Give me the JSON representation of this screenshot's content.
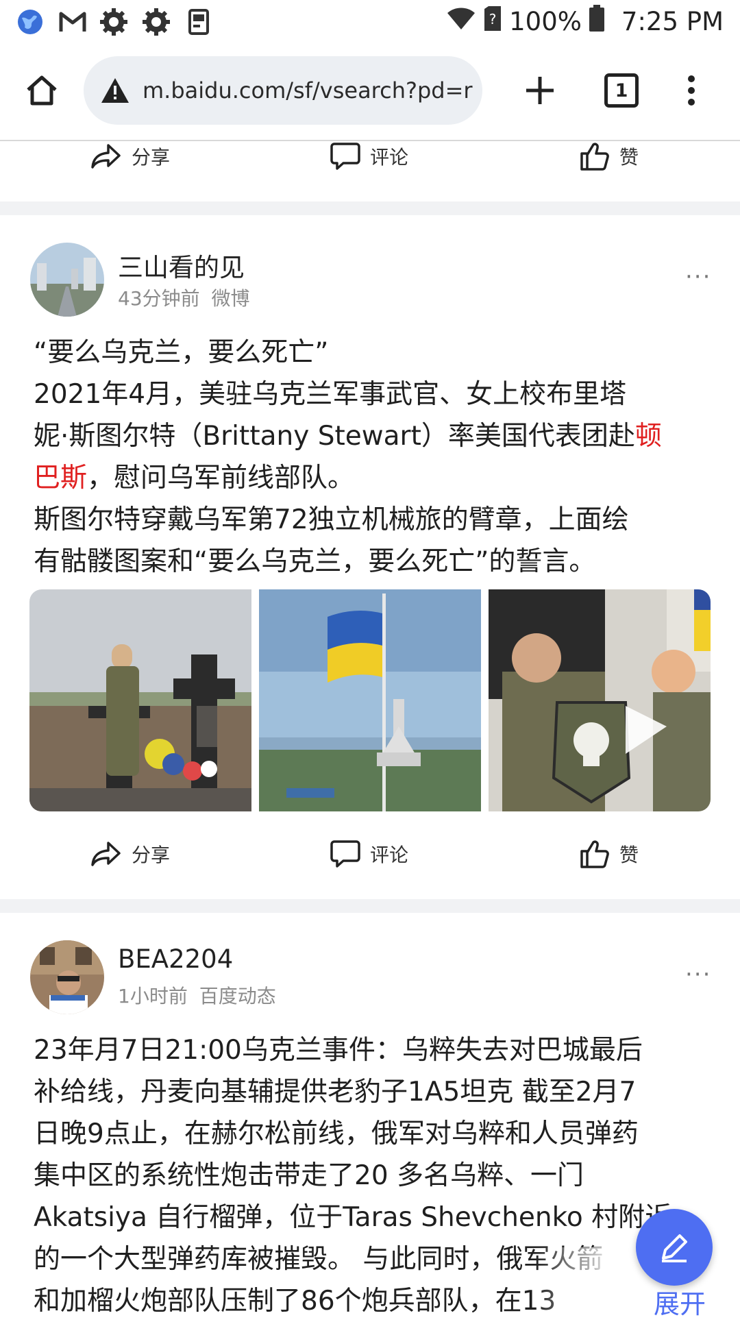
{
  "status_bar": {
    "battery": "100%",
    "time": "7:25 PM",
    "icons": [
      "globe-icon",
      "gmail-icon",
      "settings-gear-icon",
      "settings-gear-icon",
      "reader-app-icon",
      "wifi-icon",
      "sim-unknown-icon",
      "battery-icon"
    ]
  },
  "browser": {
    "url": "m.baidu.com/sf/vsearch?pd=r",
    "tab_count": "1",
    "icons": [
      "home-icon",
      "warning-icon",
      "new-tab-plus-icon",
      "tab-switcher-icon",
      "overflow-menu-icon"
    ]
  },
  "actions": {
    "share": "分享",
    "comment": "评论",
    "like": "赞"
  },
  "posts": [
    {
      "author": "三山看的见",
      "time": "43分钟前",
      "source": "微博",
      "more": "···",
      "lines": [
        "“要么乌克兰，要么死亡”",
        "2021年4月，美驻乌克兰军事武官、女上校布里塔",
        "妮·斯图尔特（Brittany Stewart）率美国代表团赴",
        "顿",
        "巴斯",
        "，慰问乌军前线部队。",
        "斯图尔特穿戴乌军第72独立机械旅的臂章，上面绘",
        "有骷髅图案和“要么乌克兰，要么死亡”的誓言。"
      ],
      "images": [
        "photo-officer-at-memorial-cross",
        "photo-ukraine-flag-motherland-monument",
        "photo-officers-skull-patch"
      ]
    },
    {
      "author": "BEA2204",
      "time": "1小时前",
      "source": "百度动态",
      "more": "···",
      "lines": [
        "23年月7日21:00乌克兰事件：乌粹失去对巴城最后",
        "补给线，丹麦向基辅提供老豹子1A5坦克 截至2月7",
        "日晚9点止，在赫尔松前线，俄军对乌粹和人员弹药",
        "集中区的系统性炮击带走了20 多名乌粹、一门",
        "Akatsiya 自行榴弹，位于Taras Shevchenko 村附近",
        "的一个大型弹药库被摧毁。 与此同时，俄军火箭",
        "和加榴火炮部队压制了86个炮兵部队，在13"
      ]
    }
  ],
  "expand_label": "展开",
  "colors": {
    "accent": "#4e6ef2",
    "highlight": "#e02020"
  }
}
